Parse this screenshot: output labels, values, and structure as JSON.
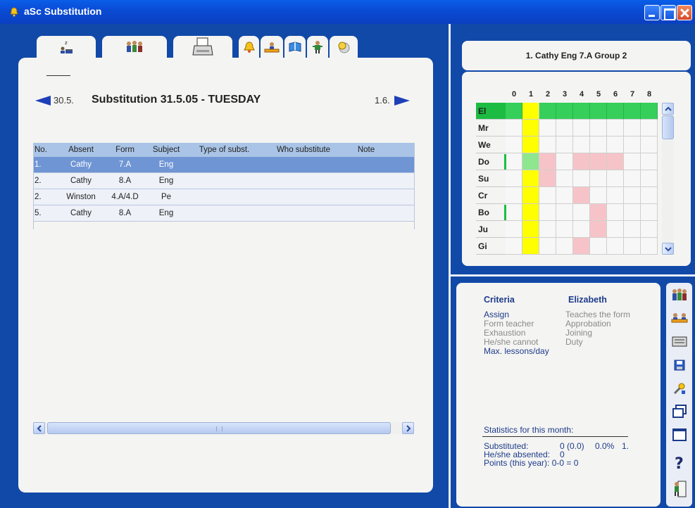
{
  "window": {
    "title": "aSc Substitution"
  },
  "toolbar_tabs": [
    {
      "icon": "sleeping-teacher-icon"
    },
    {
      "icon": "teachers-group-icon"
    },
    {
      "icon": "printer-icon"
    },
    {
      "icon": "bell-icon"
    },
    {
      "icon": "classroom-icon"
    },
    {
      "icon": "book-icon"
    },
    {
      "icon": "person-icon"
    },
    {
      "icon": "coin-icon"
    }
  ],
  "navigation": {
    "prev_date": "30.5.",
    "next_date": "1.6.",
    "title": "Substitution 31.5.05 - TUESDAY"
  },
  "table": {
    "columns": [
      "No.",
      "Absent",
      "Form",
      "Subject",
      "Type of subst.",
      "Who substitute",
      "Note"
    ],
    "rows": [
      {
        "no": "1.",
        "absent": "Cathy",
        "form": "7.A",
        "subject": "Eng",
        "type": "",
        "who": "",
        "note": "",
        "selected": true
      },
      {
        "no": "2.",
        "absent": "Cathy",
        "form": "8.A",
        "subject": "Eng",
        "type": "",
        "who": "",
        "note": ""
      },
      {
        "no": "2.",
        "absent": "Winston",
        "form": "4.A/4.D",
        "subject": "Pe",
        "type": "",
        "who": "",
        "note": ""
      },
      {
        "no": "5.",
        "absent": "Cathy",
        "form": "8.A",
        "subject": "Eng",
        "type": "",
        "who": "",
        "note": ""
      }
    ]
  },
  "lesson_info": {
    "text": "1. Cathy Eng 7.A Group 2"
  },
  "timetable": {
    "periods": [
      "0",
      "1",
      "2",
      "3",
      "4",
      "5",
      "6",
      "7",
      "8"
    ],
    "teachers": [
      "El",
      "Mr",
      "We",
      "Do",
      "Su",
      "Cr",
      "Bo",
      "Ju",
      "Gi"
    ],
    "colors": {
      "free": "#35cf5a",
      "current": "#ffff00",
      "busy": "#f6c4c8",
      "available": "#8ee68e"
    }
  },
  "criteria": {
    "header": "Criteria",
    "teacher": "Elizabeth",
    "left": [
      {
        "label": "Assign",
        "active": true
      },
      {
        "label": "Form teacher",
        "active": false
      },
      {
        "label": "Exhaustion",
        "active": false
      },
      {
        "label": "He/she cannot",
        "active": false
      },
      {
        "label": "Max. lessons/day",
        "active": true
      }
    ],
    "right": [
      {
        "label": "Teaches the form"
      },
      {
        "label": "Approbation"
      },
      {
        "label": "Joining"
      },
      {
        "label": "Duty"
      }
    ]
  },
  "statistics": {
    "title": "Statistics for this month:",
    "substituted_label": "Substituted:",
    "substituted_value": "0 (0.0)",
    "substituted_pct": "0.0%",
    "substituted_rank": "1.",
    "absented_label": "He/she absented:",
    "absented_value": "0",
    "points_text": "Points (this year): 0-0 = 0"
  },
  "side_toolbar": [
    {
      "icon": "teachers-icon"
    },
    {
      "icon": "classes-icon"
    },
    {
      "icon": "classroom-board-icon"
    },
    {
      "icon": "save-icon"
    },
    {
      "icon": "tools-icon"
    },
    {
      "icon": "cascade-windows-icon"
    },
    {
      "icon": "window-icon"
    },
    {
      "icon": "help-icon"
    },
    {
      "icon": "exit-icon"
    }
  ]
}
